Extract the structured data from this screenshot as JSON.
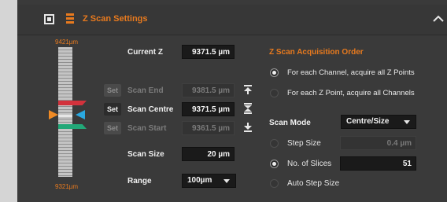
{
  "header": {
    "title": "Z Scan Settings"
  },
  "ruler": {
    "top_label": "9421µm",
    "bottom_label": "9321µm"
  },
  "fields": {
    "current_z": {
      "label": "Current Z",
      "value": "9371.5 µm"
    },
    "scan_end": {
      "set_label": "Set",
      "label": "Scan End",
      "value": "9381.5 µm"
    },
    "scan_centre": {
      "set_label": "Set",
      "label": "Scan Centre",
      "value": "9371.5 µm"
    },
    "scan_start": {
      "set_label": "Set",
      "label": "Scan Start",
      "value": "9361.5 µm"
    },
    "scan_size": {
      "label": "Scan Size",
      "value": "20 µm"
    },
    "range": {
      "label": "Range",
      "value": "100µm"
    }
  },
  "acquisition": {
    "title": "Z Scan Acquisition Order",
    "options": [
      {
        "label": "For each Channel, acquire all Z Points",
        "selected": true
      },
      {
        "label": "For each Z Point, acquire all Channels",
        "selected": false
      }
    ]
  },
  "scan_mode": {
    "label": "Scan Mode",
    "value": "Centre/Size",
    "options": [
      {
        "label": "Step Size",
        "value": "0.4 µm",
        "selected": false
      },
      {
        "label": "No. of Slices",
        "value": "51",
        "selected": true
      },
      {
        "label": "Auto Step Size",
        "selected": false
      }
    ]
  },
  "colors": {
    "accent": "#e87a1e",
    "end_marker": "#d2323c",
    "centre_marker": "#2aa8e0",
    "start_marker": "#22a878",
    "current_marker": "#f08a24"
  }
}
